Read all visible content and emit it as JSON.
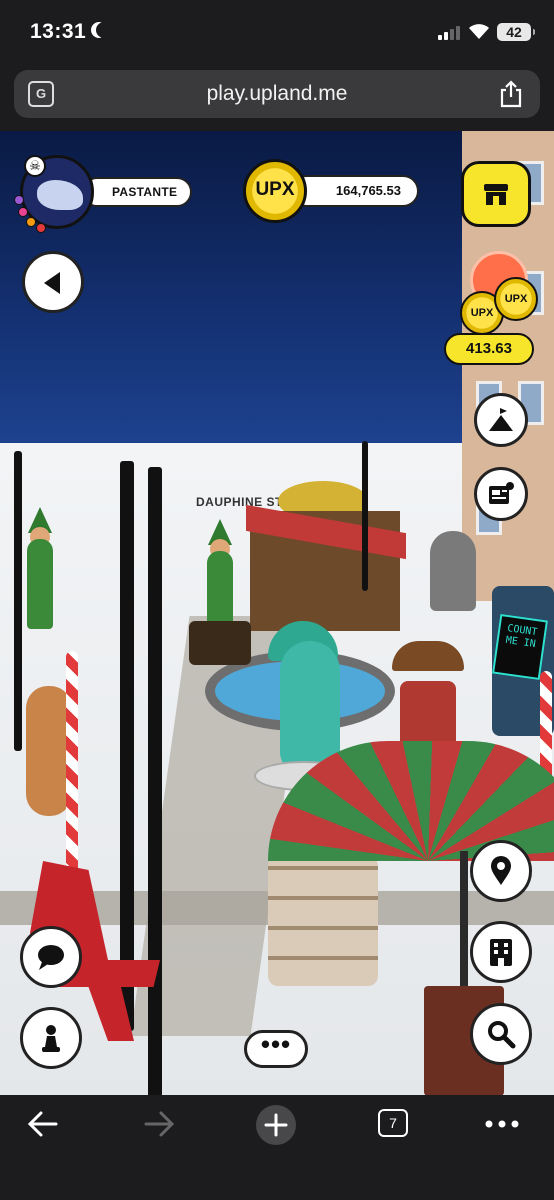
{
  "status_bar": {
    "time": "13:31",
    "battery": "42"
  },
  "browser": {
    "url": "play.upland.me",
    "open_tabs": "7",
    "translate_label": "G"
  },
  "game": {
    "street_sign": "DAUPHINE ST",
    "robot_screen_text": "COUNT ME IN"
  },
  "hud": {
    "username": "PASTANTE",
    "upx_coin_label": "UPX",
    "upx_balance": "164,765.53",
    "earnings": "413.63",
    "earnings_coin_label": "UPX",
    "more_menu": "•••"
  },
  "icons": {
    "store": "store-icon",
    "back": "back-arrow-icon",
    "terrain": "mountain-flag-icon",
    "news": "newspaper-icon",
    "location": "map-pin-icon",
    "buildings": "building-icon",
    "chat": "chat-bubble-icon",
    "avatar": "chess-pawn-icon",
    "search": "magnifier-icon"
  },
  "colors": {
    "upx_yellow": "#f6e52a",
    "sky": "#16357a",
    "browser_chrome": "#1c1c1e"
  }
}
